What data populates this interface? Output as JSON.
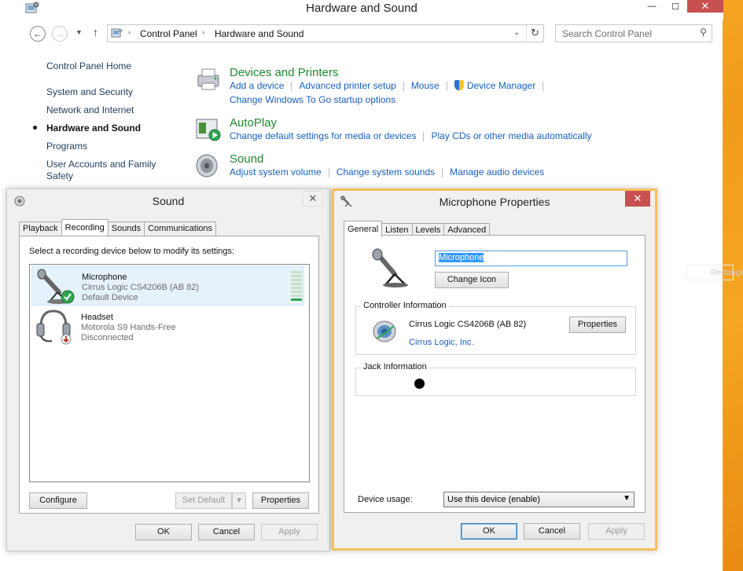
{
  "window": {
    "title": "Hardware and Sound"
  },
  "address": {
    "crumbs": [
      "Control Panel",
      "Hardware and Sound"
    ],
    "search_placeholder": "Search Control Panel"
  },
  "leftnav": {
    "home": "Control Panel Home",
    "items": [
      "System and Security",
      "Network and Internet",
      "Hardware and Sound",
      "Programs",
      "User Accounts and Family Safety"
    ]
  },
  "categories": [
    {
      "title": "Devices and Printers",
      "links_row1": [
        "Add a device",
        "Advanced printer setup",
        "Mouse",
        "Device Manager"
      ],
      "links_row2": [
        "Change Windows To Go startup options"
      ]
    },
    {
      "title": "AutoPlay",
      "links_row1": [
        "Change default settings for media or devices",
        "Play CDs or other media automatically"
      ]
    },
    {
      "title": "Sound",
      "links_row1": [
        "Adjust system volume",
        "Change system sounds",
        "Manage audio devices"
      ]
    }
  ],
  "background_text": "Rectangle",
  "sound_dialog": {
    "title": "Sound",
    "tabs": [
      "Playback",
      "Recording",
      "Sounds",
      "Communications"
    ],
    "active_tab": "Recording",
    "instruction": "Select a recording device below to modify its settings:",
    "devices": [
      {
        "name": "Microphone",
        "driver": "Cirrus Logic CS4206B (AB 82)",
        "status": "Default Device"
      },
      {
        "name": "Headset",
        "driver": "Motorola S9 Hands-Free",
        "status": "Disconnected"
      }
    ],
    "buttons": {
      "configure": "Configure",
      "set_default": "Set Default",
      "properties": "Properties",
      "ok": "OK",
      "cancel": "Cancel",
      "apply": "Apply"
    }
  },
  "mic_dialog": {
    "title": "Microphone Properties",
    "tabs": [
      "General",
      "Listen",
      "Levels",
      "Advanced"
    ],
    "active_tab": "General",
    "device_name": "Microphone",
    "change_icon": "Change Icon",
    "controller_label": "Controller Information",
    "controller_name": "Cirrus Logic CS4206B (AB 82)",
    "controller_vendor": "Cirrus Logic, Inc.",
    "properties": "Properties",
    "jack_label": "Jack Information",
    "device_usage_label": "Device usage:",
    "device_usage_value": "Use this device (enable)",
    "buttons": {
      "ok": "OK",
      "cancel": "Cancel",
      "apply": "Apply"
    }
  },
  "colors": {
    "link": "#1760c0",
    "category_title": "#1e8a2e",
    "close_red": "#c75050",
    "desktop": "#f5a623"
  }
}
